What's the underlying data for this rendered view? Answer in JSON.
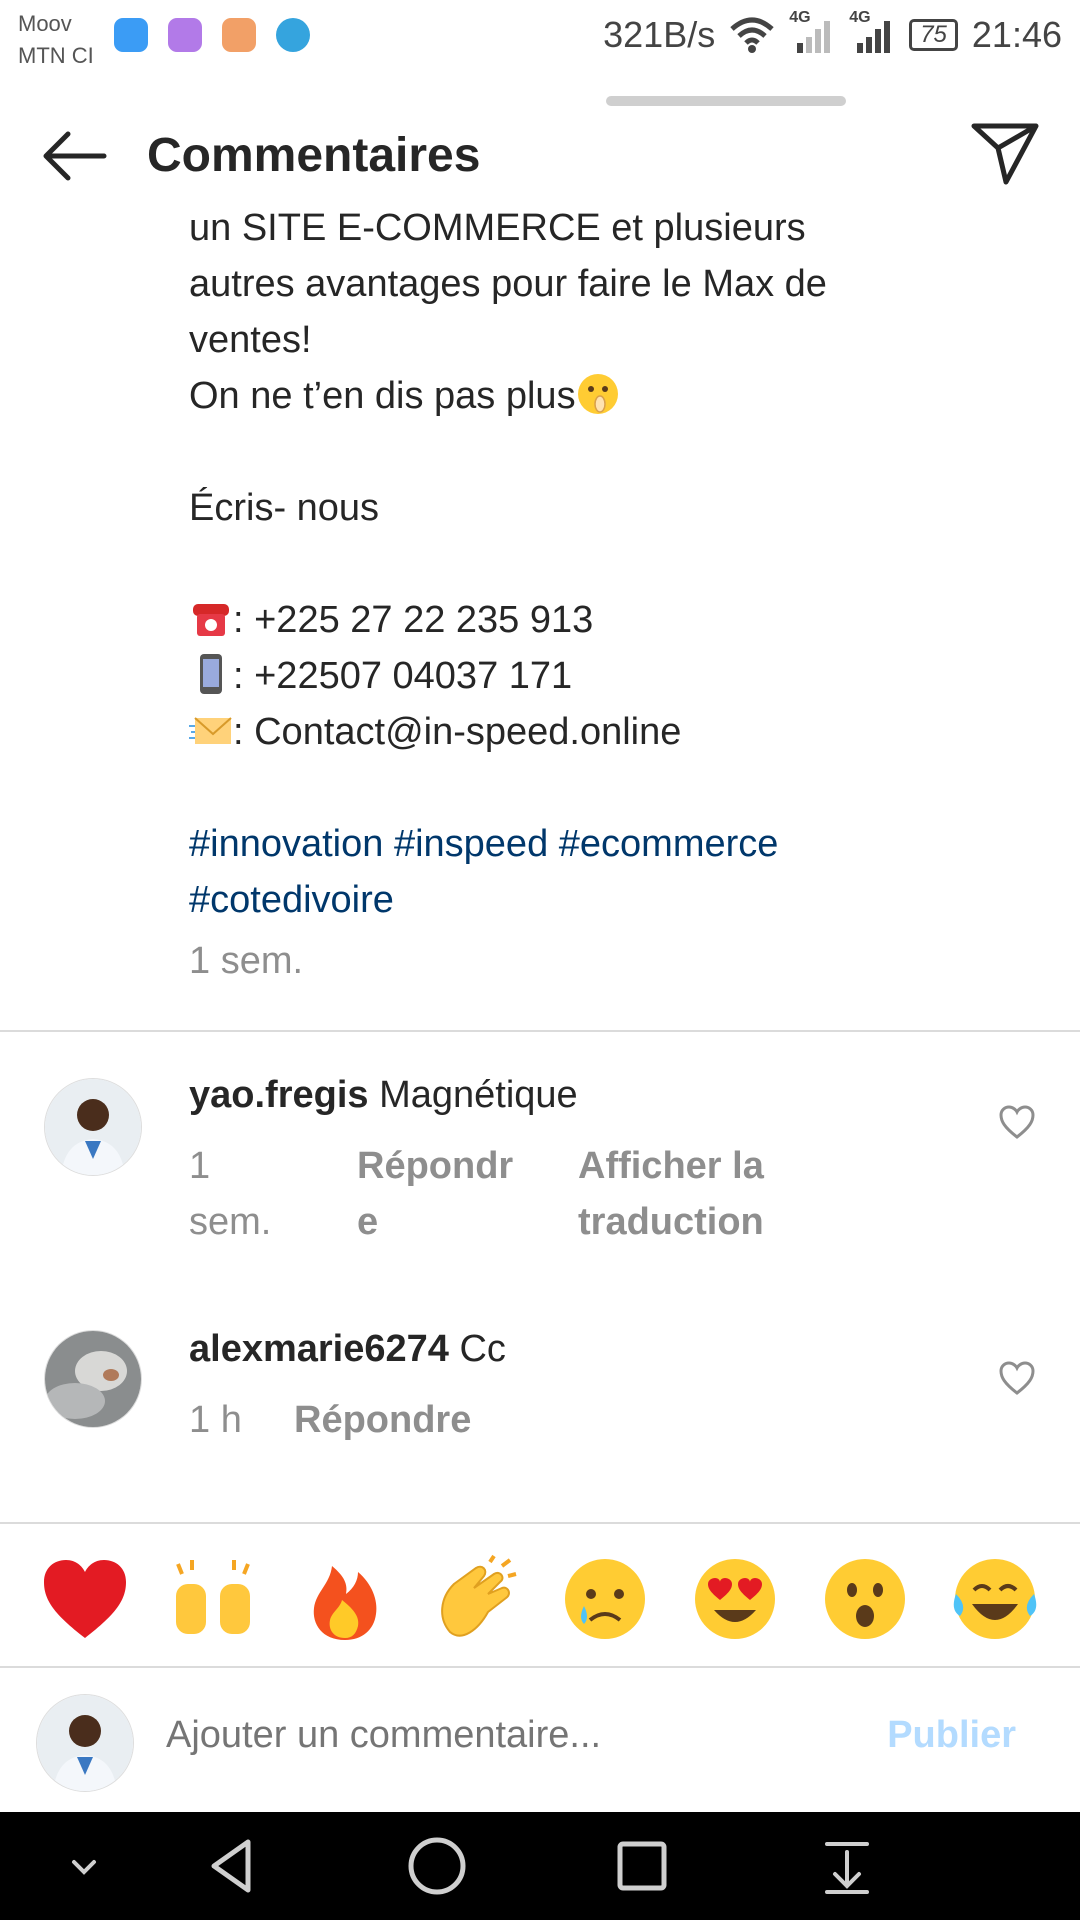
{
  "status_bar": {
    "carrier1": "Moov",
    "carrier2": "MTN CI",
    "net_speed": "321B/s",
    "signal1_label": "4G",
    "signal2_label": "4G",
    "battery": "75",
    "time": "21:46"
  },
  "header": {
    "title": "Commentaires",
    "back_icon": "arrow-left-icon",
    "share_icon": "paper-plane-icon"
  },
  "caption": {
    "lines": {
      "l1": "un SITE E-COMMERCE et plusieurs",
      "l2": "autres avantages pour faire le Max de",
      "l3": "ventes!",
      "l4": "On ne t’en dis pas plus",
      "l5": "Écris- nous",
      "phone1": ": +225 27 22 235 913",
      "phone2": ": +22507 04037 171",
      "email": ": Contact@in-speed.online"
    },
    "hashtags": {
      "h1": "#innovation",
      "h2": "#inspeed",
      "h3": "#ecommerce",
      "h4": "#cotedivoire"
    },
    "time": "1 sem."
  },
  "comments": [
    {
      "username": "yao.fregis",
      "text": "Magnétique",
      "time_line1": "1",
      "time_line2": "sem.",
      "reply_line1": "Répondr",
      "reply_line2": "e",
      "translate_line1": "Afficher la",
      "translate_line2": "traduction"
    },
    {
      "username": "alexmarie6274",
      "text": "Cc",
      "time": "1 h",
      "reply": "Répondre"
    }
  ],
  "emoji_bar": [
    "heart",
    "raising-hands",
    "fire",
    "clapping-hands",
    "crying-face",
    "heart-eyes",
    "surprised-face",
    "tears-of-joy"
  ],
  "composer": {
    "placeholder": "Ajouter un commentaire...",
    "publish": "Publier"
  },
  "colors": {
    "hashtag": "#00376b",
    "secondary_text": "#8e8e8e",
    "publish_disabled": "#b3dbff",
    "divider": "#dbdbdb"
  }
}
